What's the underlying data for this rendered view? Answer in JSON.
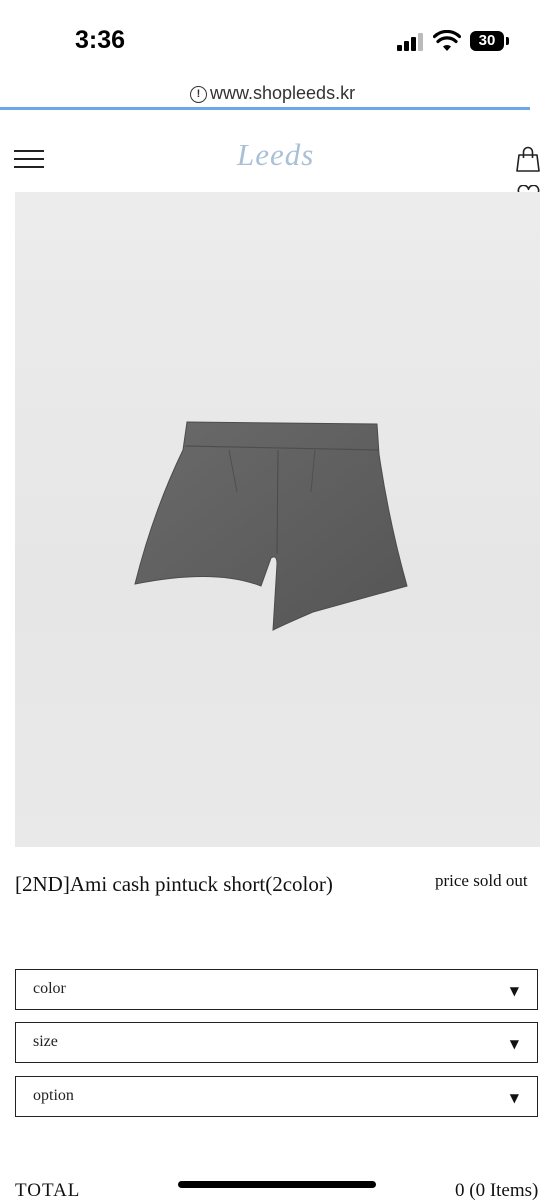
{
  "status_bar": {
    "time": "3:36",
    "battery": "30"
  },
  "browser": {
    "url": "www.shopleeds.kr"
  },
  "header": {
    "logo": "Leeds"
  },
  "product": {
    "name": "[2ND]Ami cash pintuck short(2color)",
    "price": "price sold out"
  },
  "options": [
    {
      "label": "color"
    },
    {
      "label": "size"
    },
    {
      "label": "option"
    }
  ],
  "total": {
    "label": "TOTAL",
    "value": "0 (0 Items)"
  },
  "colors": {
    "accent_loading": "#6aa8e6",
    "logo": "#a9c0d6",
    "product_bg": "#e8e8e8",
    "shorts": "#5e5e5e"
  }
}
